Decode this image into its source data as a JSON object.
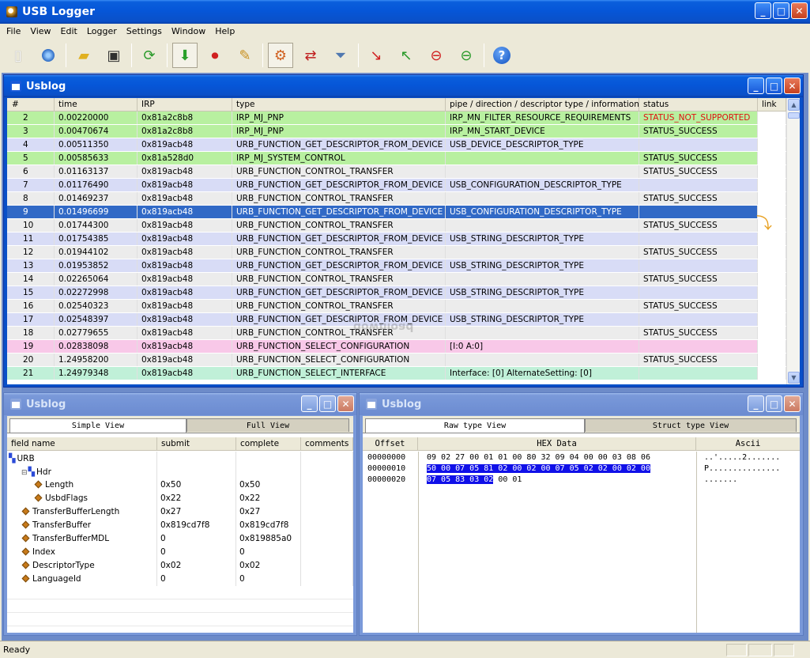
{
  "app": {
    "title": "USB Logger"
  },
  "menu": [
    "File",
    "View",
    "Edit",
    "Logger",
    "Settings",
    "Window",
    "Help"
  ],
  "toolbar_icons": [
    "new-file-icon",
    "globe-icon",
    "open-folder-icon",
    "save-icon",
    "refresh-icon",
    "download-icon",
    "stop-record-icon",
    "clear-icon",
    "settings-gear-icon",
    "swap-arrows-icon",
    "filter-icon",
    "arrow-down-red-icon",
    "arrow-up-multi-icon",
    "arrow-down-stop-icon",
    "arrow-up-stop-icon",
    "help-icon"
  ],
  "log_window": {
    "title": "Usblog",
    "columns": [
      "#",
      "time",
      "IRP",
      "type",
      "pipe / direction / descriptor type / information",
      "status",
      "link"
    ],
    "rows": [
      {
        "n": "2",
        "time": "0.00220000",
        "irp": "0x81a2c8b8",
        "type": "IRP_MJ_PNP",
        "info": "IRP_MN_FILTER_RESOURCE_REQUIREMENTS",
        "status": "STATUS_NOT_SUPPORTED",
        "color": "green",
        "status_red": true
      },
      {
        "n": "3",
        "time": "0.00470674",
        "irp": "0x81a2c8b8",
        "type": "IRP_MJ_PNP",
        "info": "IRP_MN_START_DEVICE",
        "status": "STATUS_SUCCESS",
        "color": "green"
      },
      {
        "n": "4",
        "time": "0.00511350",
        "irp": "0x819acb48",
        "type": "URB_FUNCTION_GET_DESCRIPTOR_FROM_DEVICE",
        "info": "USB_DEVICE_DESCRIPTOR_TYPE",
        "status": "",
        "color": "blue"
      },
      {
        "n": "5",
        "time": "0.00585633",
        "irp": "0x81a528d0",
        "type": "IRP_MJ_SYSTEM_CONTROL",
        "info": "",
        "status": "STATUS_SUCCESS",
        "color": "green"
      },
      {
        "n": "6",
        "time": "0.01163137",
        "irp": "0x819acb48",
        "type": "URB_FUNCTION_CONTROL_TRANSFER",
        "info": "",
        "status": "STATUS_SUCCESS",
        "color": "grey"
      },
      {
        "n": "7",
        "time": "0.01176490",
        "irp": "0x819acb48",
        "type": "URB_FUNCTION_GET_DESCRIPTOR_FROM_DEVICE",
        "info": "USB_CONFIGURATION_DESCRIPTOR_TYPE",
        "status": "",
        "color": "blue"
      },
      {
        "n": "8",
        "time": "0.01469237",
        "irp": "0x819acb48",
        "type": "URB_FUNCTION_CONTROL_TRANSFER",
        "info": "",
        "status": "STATUS_SUCCESS",
        "color": "grey"
      },
      {
        "n": "9",
        "time": "0.01496699",
        "irp": "0x819acb48",
        "type": "URB_FUNCTION_GET_DESCRIPTOR_FROM_DEVICE",
        "info": "USB_CONFIGURATION_DESCRIPTOR_TYPE",
        "status": "",
        "color": "sel"
      },
      {
        "n": "10",
        "time": "0.01744300",
        "irp": "0x819acb48",
        "type": "URB_FUNCTION_CONTROL_TRANSFER",
        "info": "",
        "status": "STATUS_SUCCESS",
        "color": "grey"
      },
      {
        "n": "11",
        "time": "0.01754385",
        "irp": "0x819acb48",
        "type": "URB_FUNCTION_GET_DESCRIPTOR_FROM_DEVICE",
        "info": "USB_STRING_DESCRIPTOR_TYPE",
        "status": "",
        "color": "blue"
      },
      {
        "n": "12",
        "time": "0.01944102",
        "irp": "0x819acb48",
        "type": "URB_FUNCTION_CONTROL_TRANSFER",
        "info": "",
        "status": "STATUS_SUCCESS",
        "color": "grey"
      },
      {
        "n": "13",
        "time": "0.01953852",
        "irp": "0x819acb48",
        "type": "URB_FUNCTION_GET_DESCRIPTOR_FROM_DEVICE",
        "info": "USB_STRING_DESCRIPTOR_TYPE",
        "status": "",
        "color": "blue"
      },
      {
        "n": "14",
        "time": "0.02265064",
        "irp": "0x819acb48",
        "type": "URB_FUNCTION_CONTROL_TRANSFER",
        "info": "",
        "status": "STATUS_SUCCESS",
        "color": "grey"
      },
      {
        "n": "15",
        "time": "0.02272998",
        "irp": "0x819acb48",
        "type": "URB_FUNCTION_GET_DESCRIPTOR_FROM_DEVICE",
        "info": "USB_STRING_DESCRIPTOR_TYPE",
        "status": "",
        "color": "blue"
      },
      {
        "n": "16",
        "time": "0.02540323",
        "irp": "0x819acb48",
        "type": "URB_FUNCTION_CONTROL_TRANSFER",
        "info": "",
        "status": "STATUS_SUCCESS",
        "color": "grey"
      },
      {
        "n": "17",
        "time": "0.02548397",
        "irp": "0x819acb48",
        "type": "URB_FUNCTION_GET_DESCRIPTOR_FROM_DEVICE",
        "info": "USB_STRING_DESCRIPTOR_TYPE",
        "status": "",
        "color": "blue"
      },
      {
        "n": "18",
        "time": "0.02779655",
        "irp": "0x819acb48",
        "type": "URB_FUNCTION_CONTROL_TRANSFER",
        "info": "",
        "status": "STATUS_SUCCESS",
        "color": "grey"
      },
      {
        "n": "19",
        "time": "0.02838098",
        "irp": "0x819acb48",
        "type": "URB_FUNCTION_SELECT_CONFIGURATION",
        "info": "[I:0 A:0]",
        "status": "",
        "color": "pink"
      },
      {
        "n": "20",
        "time": "1.24958200",
        "irp": "0x819acb48",
        "type": "URB_FUNCTION_SELECT_CONFIGURATION",
        "info": "",
        "status": "STATUS_SUCCESS",
        "color": "grey"
      },
      {
        "n": "21",
        "time": "1.24979348",
        "irp": "0x819acb48",
        "type": "URB_FUNCTION_SELECT_INTERFACE",
        "info": "Interface: [0]   AlternateSetting: [0]",
        "status": "",
        "color": "mint"
      }
    ]
  },
  "simple_window": {
    "title": "Usblog",
    "tabs": [
      "Simple View",
      "Full View"
    ],
    "columns": [
      "field name",
      "submit",
      "complete",
      "comments"
    ],
    "rows": [
      {
        "name": "URB",
        "submit": "",
        "complete": "",
        "level": 0,
        "icon": "tree-root-icon"
      },
      {
        "name": "Hdr",
        "submit": "",
        "complete": "",
        "level": 1,
        "icon": "tree-node-icon"
      },
      {
        "name": "Length",
        "submit": "0x50",
        "complete": "0x50",
        "level": 2,
        "icon": "field-icon"
      },
      {
        "name": "UsbdFlags",
        "submit": "0x22",
        "complete": "0x22",
        "level": 2,
        "icon": "field-icon"
      },
      {
        "name": "TransferBufferLength",
        "submit": "0x27",
        "complete": "0x27",
        "level": 1,
        "icon": "field-icon"
      },
      {
        "name": "TransferBuffer",
        "submit": "0x819cd7f8",
        "complete": "0x819cd7f8",
        "level": 1,
        "icon": "field-icon"
      },
      {
        "name": "TransferBufferMDL",
        "submit": "0",
        "complete": "0x819885a0",
        "level": 1,
        "icon": "field-icon"
      },
      {
        "name": "Index",
        "submit": "0",
        "complete": "0",
        "level": 1,
        "icon": "field-icon"
      },
      {
        "name": "DescriptorType",
        "submit": "0x02",
        "complete": "0x02",
        "level": 1,
        "icon": "field-icon"
      },
      {
        "name": "LanguageId",
        "submit": "0",
        "complete": "0",
        "level": 1,
        "icon": "field-icon"
      }
    ]
  },
  "raw_window": {
    "title": "Usblog",
    "tabs": [
      "Raw type View",
      "Struct type View"
    ],
    "columns": [
      "Offset",
      "HEX Data",
      "Ascii"
    ],
    "rows": [
      {
        "offset": "00000000",
        "hex_plain": "09 02 27 00 01 01 00 80 32 09 04 00 00 03 08 06",
        "hex_sel": "",
        "hex_after": "",
        "ascii": "..'.....2......."
      },
      {
        "offset": "00000010",
        "hex_plain": "",
        "hex_sel": "50 00 07 05 81 02 00 02 00 07 05 02 02 00 02 00",
        "hex_after": "",
        "ascii": "P..............."
      },
      {
        "offset": "00000020",
        "hex_plain": "",
        "hex_sel": "07 05 83 03 02",
        "hex_after": " 00 01",
        "ascii": "......."
      }
    ]
  },
  "watermark": "download",
  "status": {
    "text": "Ready"
  }
}
